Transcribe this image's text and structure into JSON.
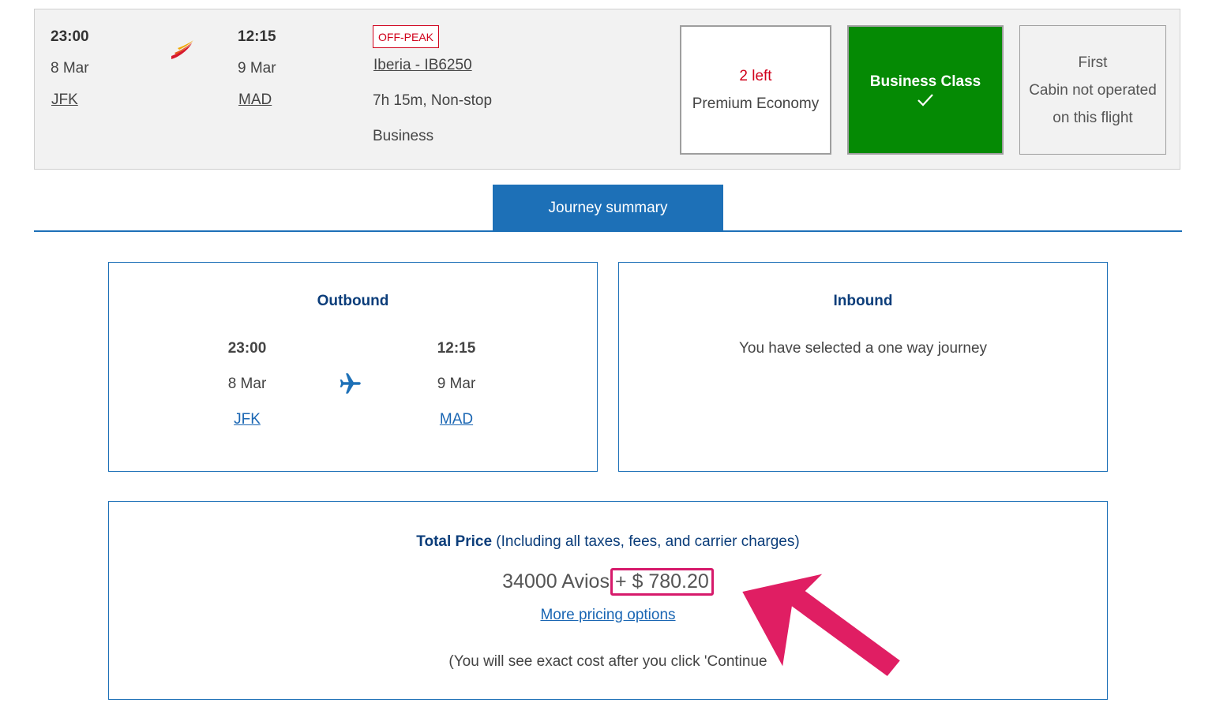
{
  "flight": {
    "depart_time": "23:00",
    "depart_date": "8 Mar",
    "depart_airport": "JFK",
    "arrive_time": "12:15",
    "arrive_date": "9 Mar",
    "arrive_airport": "MAD",
    "badge": "OFF-PEAK",
    "flight_link": "Iberia - IB6250",
    "duration": "7h 15m, Non-stop",
    "cabin": "Business",
    "airline_logo_icon": "iberia-logo-icon"
  },
  "cabins": {
    "premium_economy": {
      "availability": "2 left",
      "label": "Premium Economy"
    },
    "business": {
      "label": "Business Class",
      "check_icon": "checkmark-icon"
    },
    "first": {
      "label": "First",
      "note_line1": "Cabin not operated",
      "note_line2": "on this flight"
    }
  },
  "tabs": {
    "journey_summary": "Journey summary"
  },
  "outbound": {
    "title": "Outbound",
    "depart_time": "23:00",
    "depart_date": "8 Mar",
    "depart_airport": "JFK",
    "arrive_time": "12:15",
    "arrive_date": "9 Mar",
    "arrive_airport": "MAD",
    "plane_icon": "plane-icon"
  },
  "inbound": {
    "title": "Inbound",
    "message": "You have selected a one way journey"
  },
  "price": {
    "heading_bold": "Total Price",
    "heading_note": "(Including all taxes, fees, and carrier charges)",
    "avios": "34000 Avios",
    "amount": "+ $ 780.20",
    "more_options": "More pricing options",
    "note": "(You will see exact cost after you click 'Continue"
  },
  "colors": {
    "brand_blue": "#1d70b7",
    "business_green": "#058a04",
    "alert_red": "#d0011b",
    "annotation_pink": "#d61a6b"
  }
}
